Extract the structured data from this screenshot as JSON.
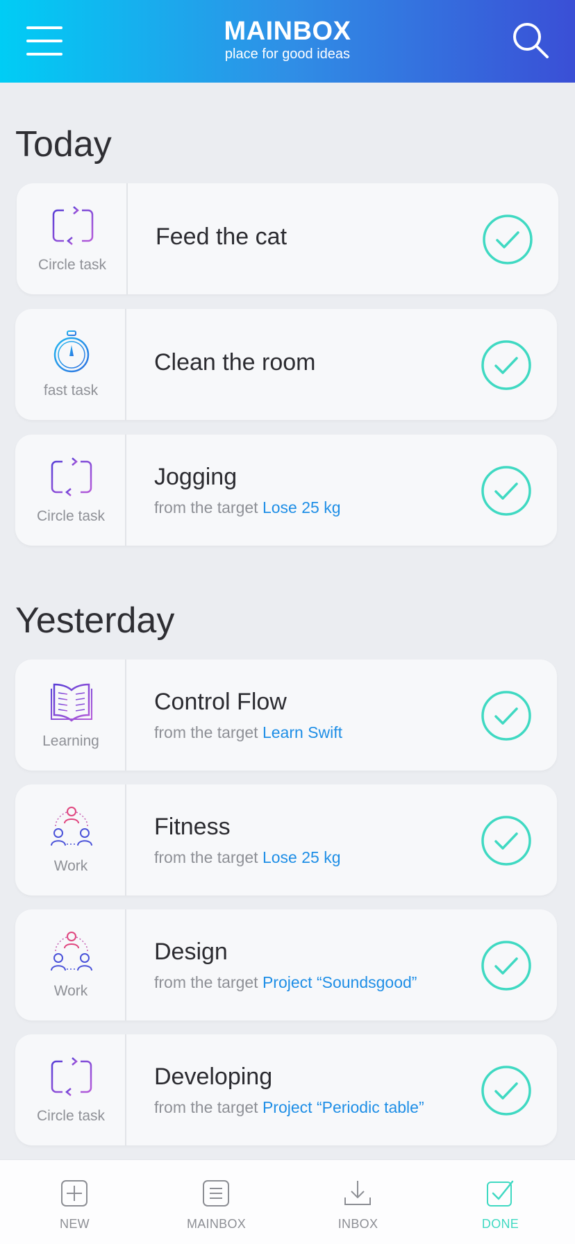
{
  "header": {
    "title": "MAINBOX",
    "subtitle": "place for good ideas"
  },
  "sections": {
    "today": "Today",
    "yesterday": "Yesterday"
  },
  "tasks": [
    {
      "type": "Circle task",
      "icon": "repeat-icon",
      "title": "Feed the cat",
      "sub_prefix": "",
      "target": ""
    },
    {
      "type": "fast task",
      "icon": "stopwatch-icon",
      "title": "Clean the room",
      "sub_prefix": "",
      "target": ""
    },
    {
      "type": "Circle task",
      "icon": "repeat-icon",
      "title": "Jogging",
      "sub_prefix": "from the target ",
      "target": "Lose 25 kg"
    },
    {
      "type": "Learning",
      "icon": "book-icon",
      "title": "Control Flow",
      "sub_prefix": "from the target ",
      "target": "Learn Swift"
    },
    {
      "type": "Work",
      "icon": "team-icon",
      "title": "Fitness",
      "sub_prefix": "from the target ",
      "target": "Lose 25 kg"
    },
    {
      "type": "Work",
      "icon": "team-icon",
      "title": "Design",
      "sub_prefix": "from the target ",
      "target": "Project “Soundsgood”"
    },
    {
      "type": "Circle task",
      "icon": "repeat-icon",
      "title": "Developing",
      "sub_prefix": "from the target ",
      "target": "Project “Periodic table”"
    }
  ],
  "tabbar": {
    "new": "NEW",
    "mainbox": "MAINBOX",
    "inbox": "INBOX",
    "done": "DONE",
    "active": "DONE"
  },
  "colors": {
    "header_gradient": [
      "#00cdf5",
      "#3a4fd6"
    ],
    "check": "#3fd9c2",
    "target_link": "#1e8ee6",
    "active_tab": "#3fd9c2"
  }
}
